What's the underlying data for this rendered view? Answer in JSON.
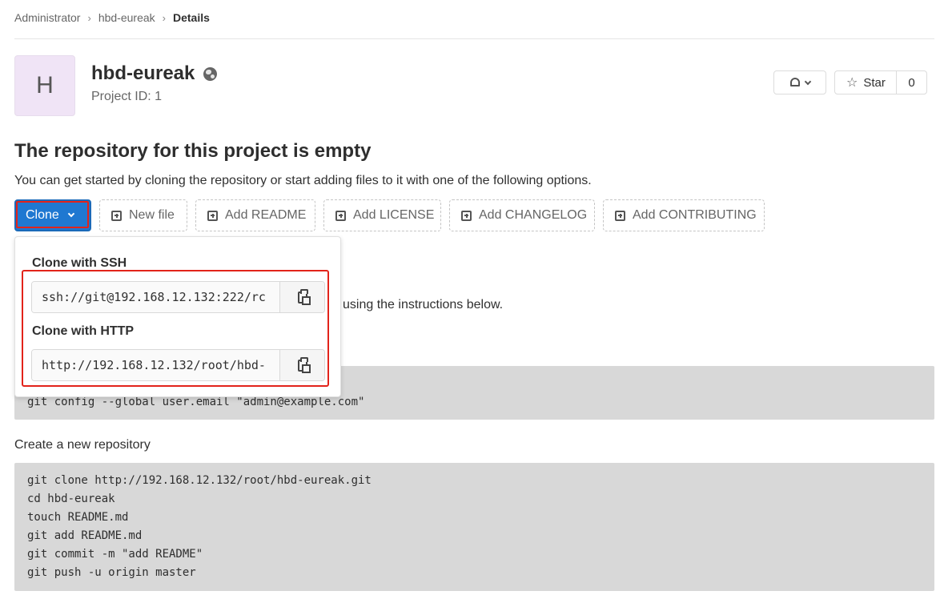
{
  "breadcrumb": {
    "items": [
      "Administrator",
      "hbd-eureak",
      "Details"
    ],
    "separator": "›"
  },
  "project": {
    "avatar_letter": "H",
    "name": "hbd-eureak",
    "id_text": "Project ID: 1",
    "visibility_icon": "globe-icon"
  },
  "actions": {
    "notification_icon": "bell-icon",
    "star_label": "Star",
    "star_count": "0"
  },
  "empty": {
    "title": "The repository for this project is empty",
    "description": "You can get started by cloning the repository or start adding files to it with one of the following options."
  },
  "buttons": {
    "clone": "Clone",
    "new_file": "New file",
    "add_readme": "Add README",
    "add_license": "Add LICENSE",
    "add_changelog": "Add CHANGELOG",
    "add_contributing": "Add CONTRIBUTING"
  },
  "clone_dropdown": {
    "ssh_label": "Clone with SSH",
    "ssh_url": "ssh://git@192.168.12.132:222/rc",
    "http_label": "Clone with HTTP",
    "http_url": "http://192.168.12.132/root/hbd-"
  },
  "background": {
    "instructions_tail": "using the instructions below.",
    "global_config_line": "git config --global user.email \"admin@example.com\"",
    "create_repo_label": "Create a new repository",
    "create_repo_lines": [
      "git clone http://192.168.12.132/root/hbd-eureak.git",
      "cd hbd-eureak",
      "touch README.md",
      "git add README.md",
      "git commit -m \"add README\"",
      "git push -u origin master"
    ]
  },
  "colors": {
    "primary": "#1f78d1",
    "highlight": "#e2231a",
    "avatar_bg": "#f0e4f6",
    "code_bg": "#d8d8d8"
  }
}
